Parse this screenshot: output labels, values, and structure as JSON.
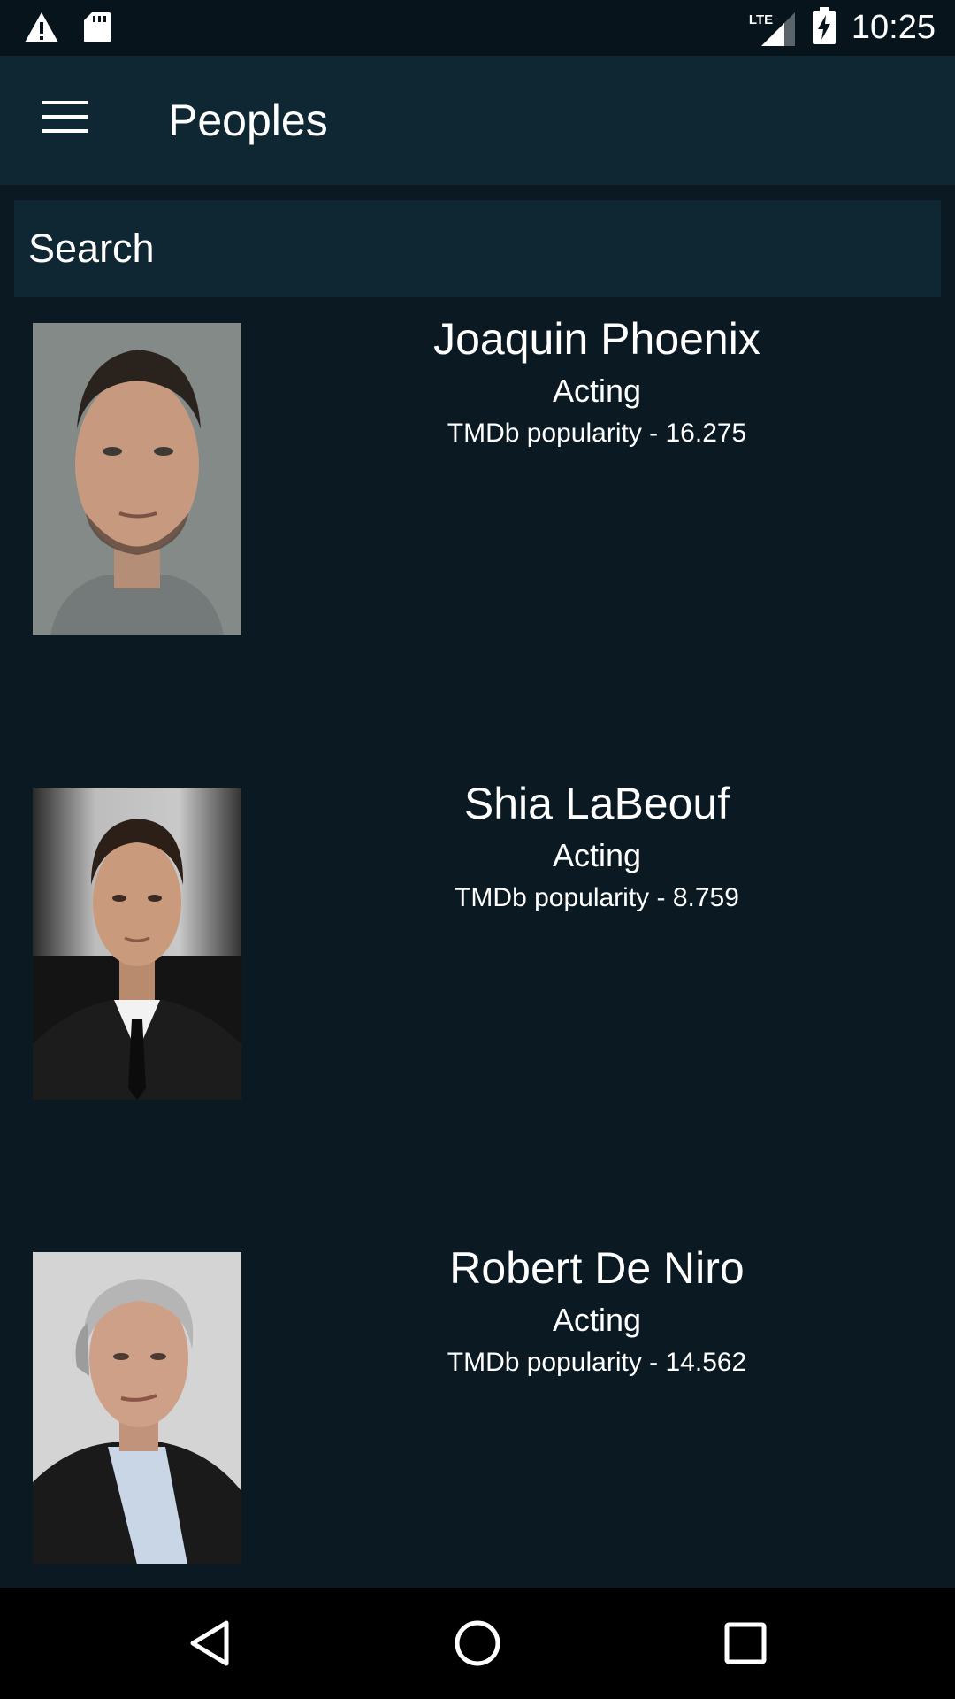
{
  "status_bar": {
    "time": "10:25",
    "network": "LTE",
    "icons": [
      "warning-icon",
      "sd-card-icon",
      "signal-icon",
      "battery-charging-icon"
    ]
  },
  "app_bar": {
    "title": "Peoples",
    "menu_icon": "hamburger-menu-icon"
  },
  "search": {
    "placeholder": "Search"
  },
  "people": [
    {
      "name": "Joaquin Phoenix",
      "department": "Acting",
      "popularity": "TMDb popularity - 16.275"
    },
    {
      "name": "Shia LaBeouf",
      "department": "Acting",
      "popularity": "TMDb popularity - 8.759"
    },
    {
      "name": "Robert De Niro",
      "department": "Acting",
      "popularity": "TMDb popularity - 14.562"
    }
  ],
  "nav_bar": {
    "icons": [
      "back-icon",
      "home-icon",
      "recents-icon"
    ]
  },
  "colors": {
    "background": "#0b1a22",
    "app_bar": "#0f2733",
    "status_bar": "#08141b",
    "text": "#ffffff"
  }
}
